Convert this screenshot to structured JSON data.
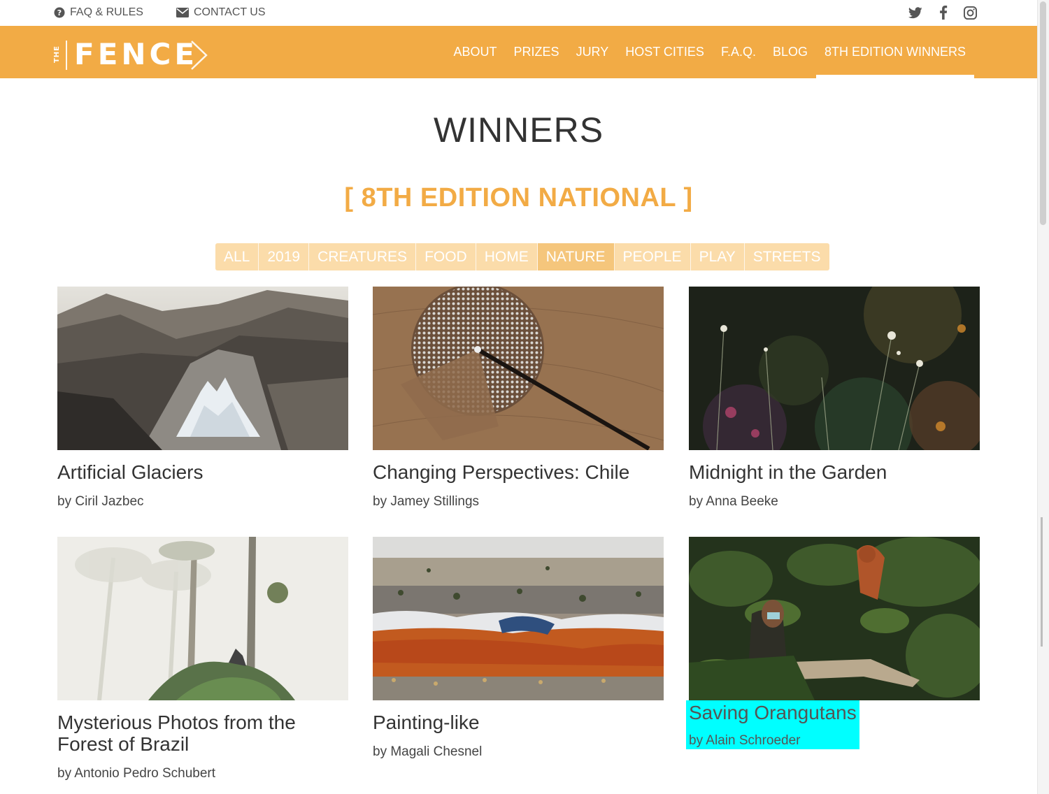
{
  "topbar": {
    "faq": {
      "label": "FAQ & RULES",
      "icon": "question-circle-icon"
    },
    "contact": {
      "label": "CONTACT US",
      "icon": "envelope-icon"
    },
    "social": [
      "twitter-icon",
      "facebook-icon",
      "instagram-icon"
    ]
  },
  "header": {
    "logo": {
      "small": "THE",
      "word": "FENCE"
    },
    "nav": [
      {
        "label": "ABOUT",
        "active": false
      },
      {
        "label": "PRIZES",
        "active": false
      },
      {
        "label": "JURY",
        "active": false
      },
      {
        "label": "HOST CITIES",
        "active": false
      },
      {
        "label": "F.A.Q.",
        "active": false
      },
      {
        "label": "BLOG",
        "active": false
      },
      {
        "label": "8TH EDITION WINNERS",
        "active": true
      }
    ]
  },
  "page": {
    "title": "WINNERS",
    "edition": "[ 8TH EDITION NATIONAL ]"
  },
  "filters": [
    {
      "label": "ALL",
      "active": false
    },
    {
      "label": "2019",
      "active": false
    },
    {
      "label": "CREATURES",
      "active": false
    },
    {
      "label": "FOOD",
      "active": false
    },
    {
      "label": "HOME",
      "active": false
    },
    {
      "label": "NATURE",
      "active": true
    },
    {
      "label": "PEOPLE",
      "active": false
    },
    {
      "label": "PLAY",
      "active": false
    },
    {
      "label": "STREETS",
      "active": false
    }
  ],
  "winners": [
    {
      "title": "Artificial Glaciers",
      "byline": "by Ciril Jazbec"
    },
    {
      "title": "Changing Perspectives: Chile",
      "byline": "by Jamey Stillings"
    },
    {
      "title": "Midnight in the Garden",
      "byline": "by Anna Beeke"
    },
    {
      "title": "Mysterious Photos from the Forest of Brazil",
      "byline": "by Antonio Pedro Schubert"
    },
    {
      "title": "Painting-like",
      "byline": "by Magali Chesnel"
    },
    {
      "title": "Saving Orangutans",
      "byline": "by Alain Schroeder",
      "highlighted": true
    }
  ],
  "colors": {
    "brand_orange": "#f2ab45",
    "filter_bg": "#fbdcaa",
    "filter_active": "#f5c67c",
    "highlight": "#00ffff"
  }
}
